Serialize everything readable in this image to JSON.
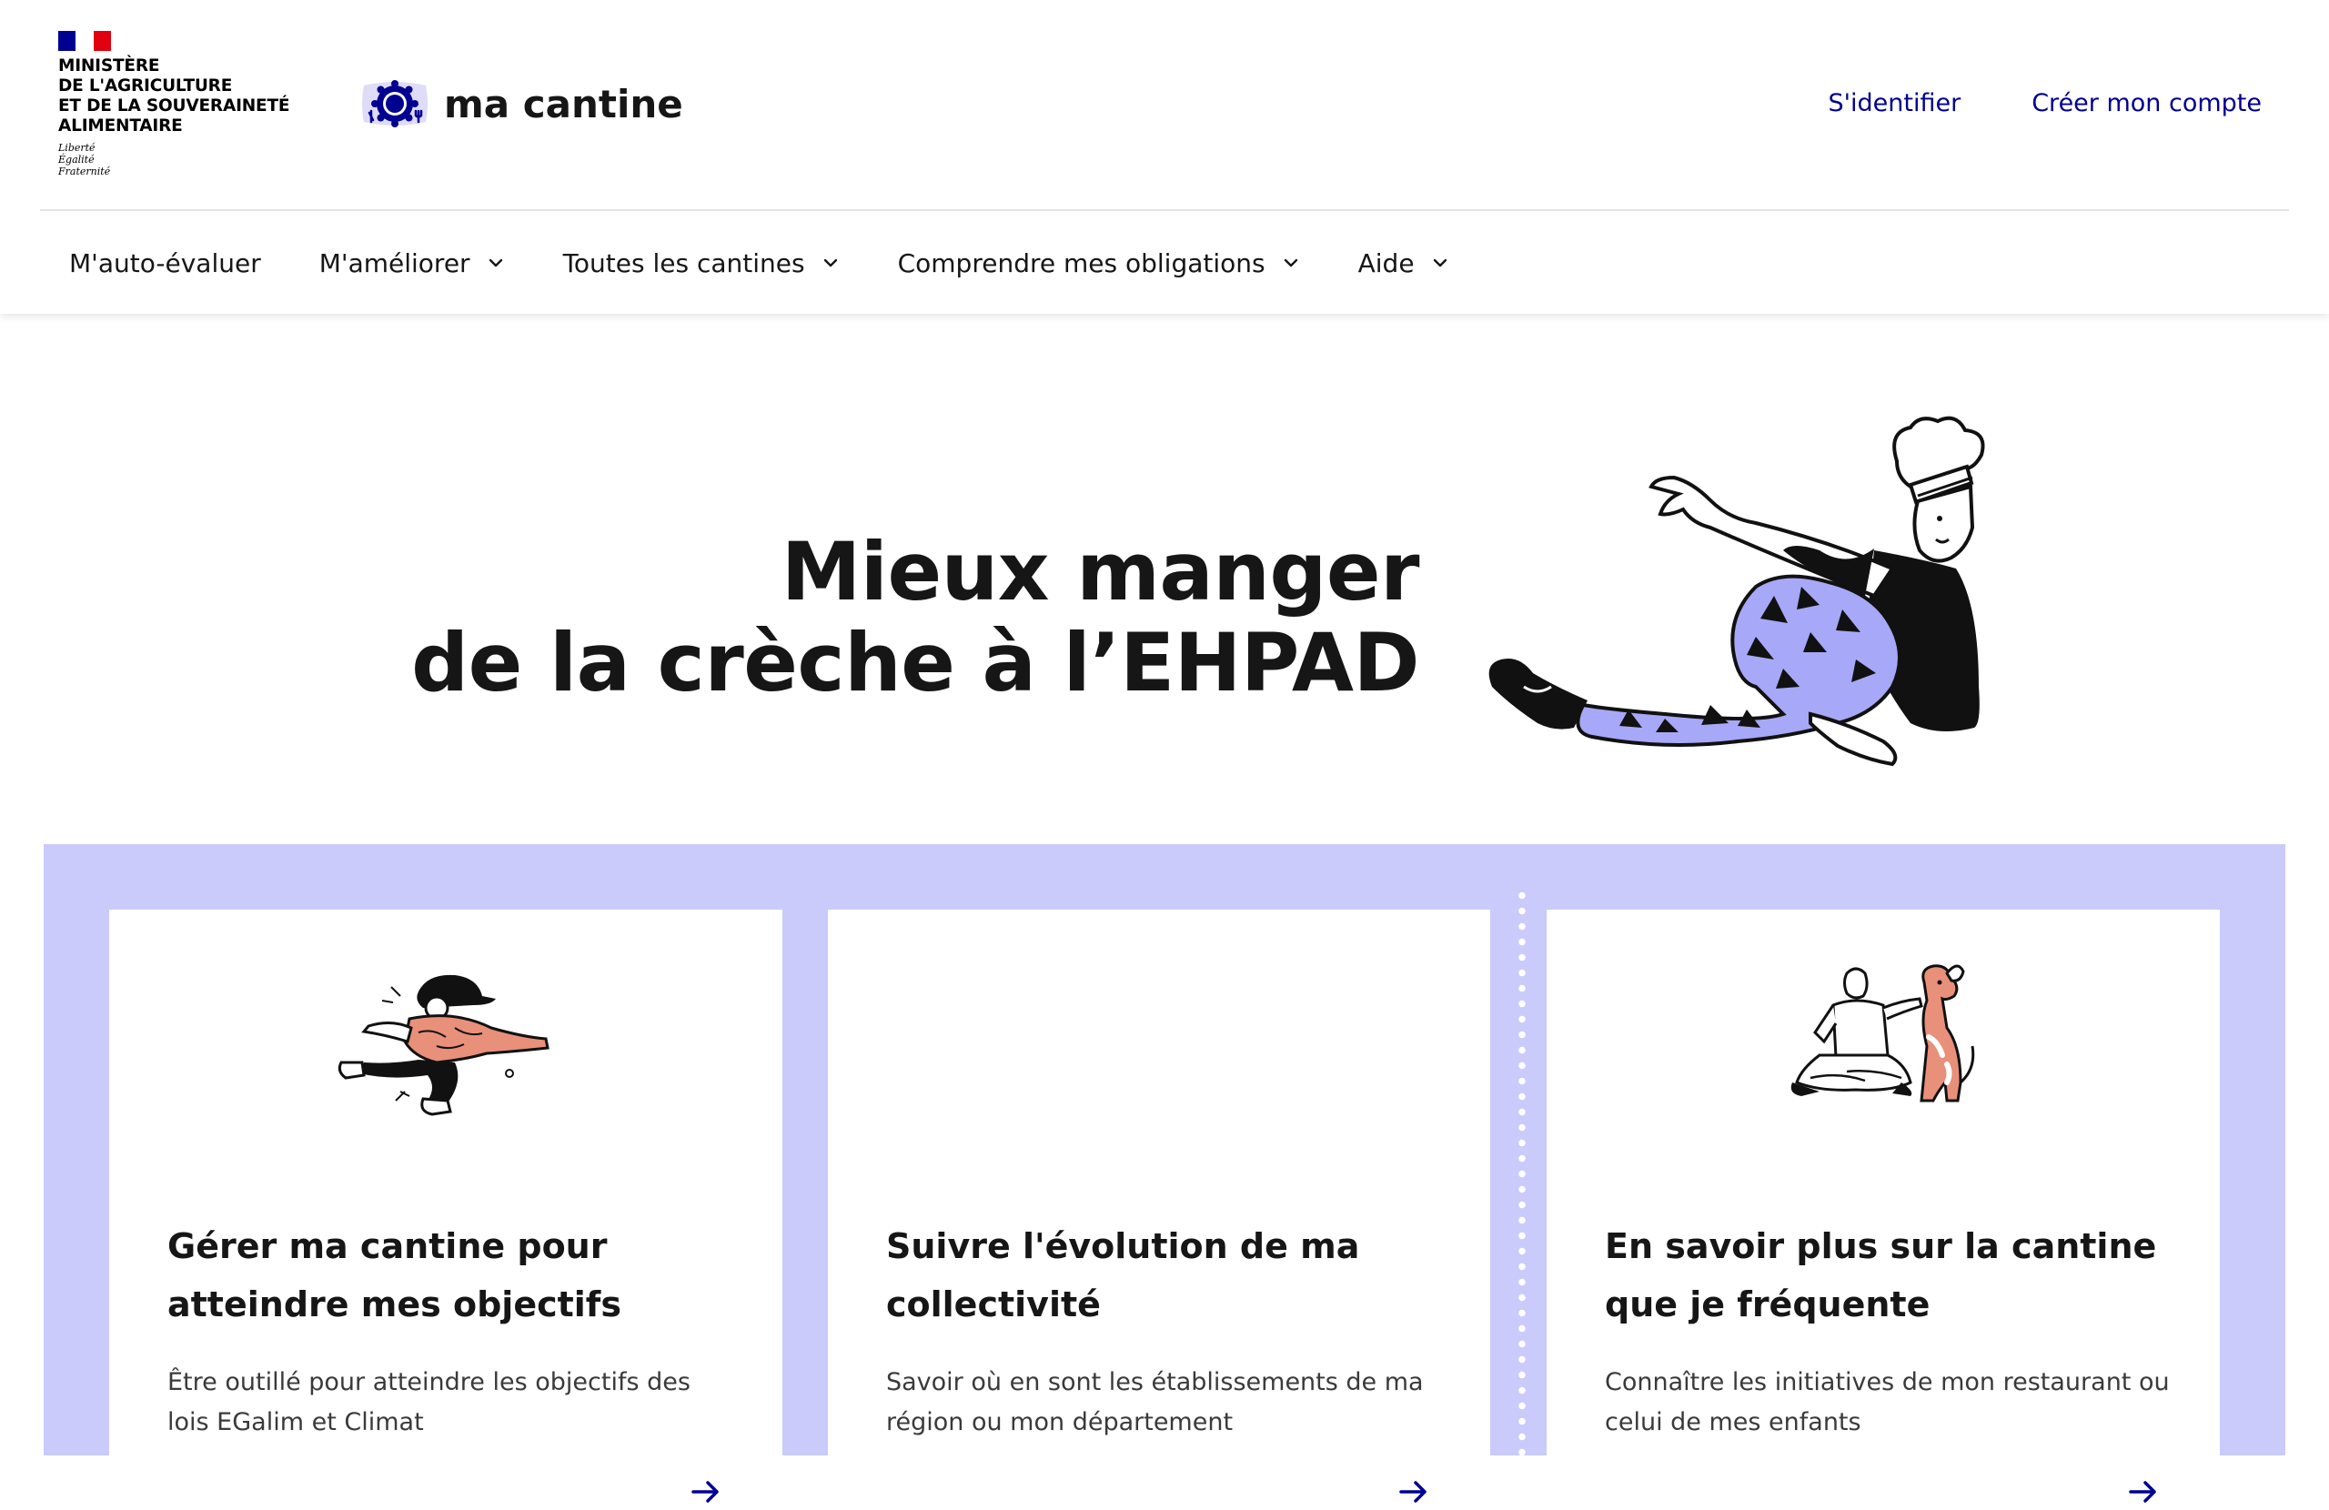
{
  "gov": {
    "ministry_lines": [
      "MINISTÈRE",
      "DE L'AGRICULTURE",
      "ET DE LA SOUVERAINETÉ",
      "ALIMENTAIRE"
    ],
    "motto_lines": [
      "Liberté",
      "Égalité",
      "Fraternité"
    ]
  },
  "brand": {
    "name": "ma cantine"
  },
  "quick_links": {
    "login": "S'identifier",
    "signup": "Créer mon compte"
  },
  "nav": {
    "items": [
      {
        "label": "M'auto-évaluer"
      },
      {
        "label": "M'améliorer"
      },
      {
        "label": "Toutes les cantines"
      },
      {
        "label": "Comprendre mes obligations"
      },
      {
        "label": "Aide"
      }
    ]
  },
  "hero": {
    "title_line1": "Mieux manger",
    "title_line2": "de la crèche à l’EHPAD"
  },
  "cards": [
    {
      "title": "Gérer ma cantine pour atteindre mes objectifs",
      "description": "Être outillé pour atteindre les objectifs des lois EGalim et Climat"
    },
    {
      "title": "Suivre l'évolution de ma collectivité",
      "description": "Savoir où en sont les établissements de ma région ou mon département"
    },
    {
      "title": "En savoir plus sur la cantine que je fréquente",
      "description": "Connaître les initiatives de mon restaurant ou celui de mes enfants"
    }
  ],
  "colors": {
    "primary_blue": "#000091",
    "section_bg": "#cacafb",
    "flag_red": "#e1000f",
    "illustration_purple": "#a8a8f8",
    "illustration_salmon": "#e8907a"
  }
}
